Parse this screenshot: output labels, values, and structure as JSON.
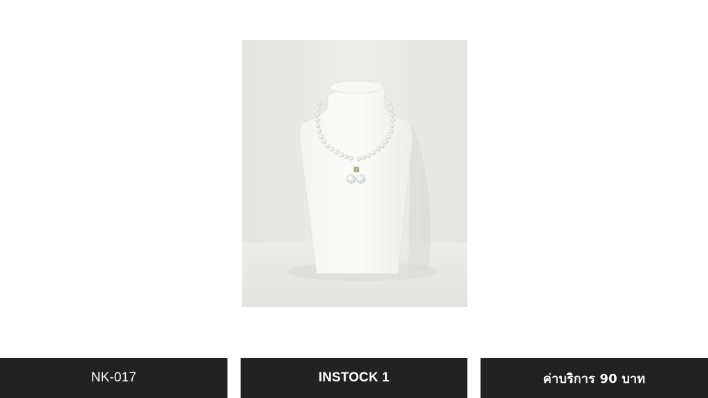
{
  "product": {
    "image_alt": "Pearl necklace on white bust display",
    "code": "NK-017",
    "stock": "INSTOCK 1",
    "service_fee": "ค่าบริการ 90 บาท"
  },
  "colors": {
    "bar_background": "#222222",
    "bar_text": "#ffffff",
    "photo_background": "#e8e8e6"
  }
}
